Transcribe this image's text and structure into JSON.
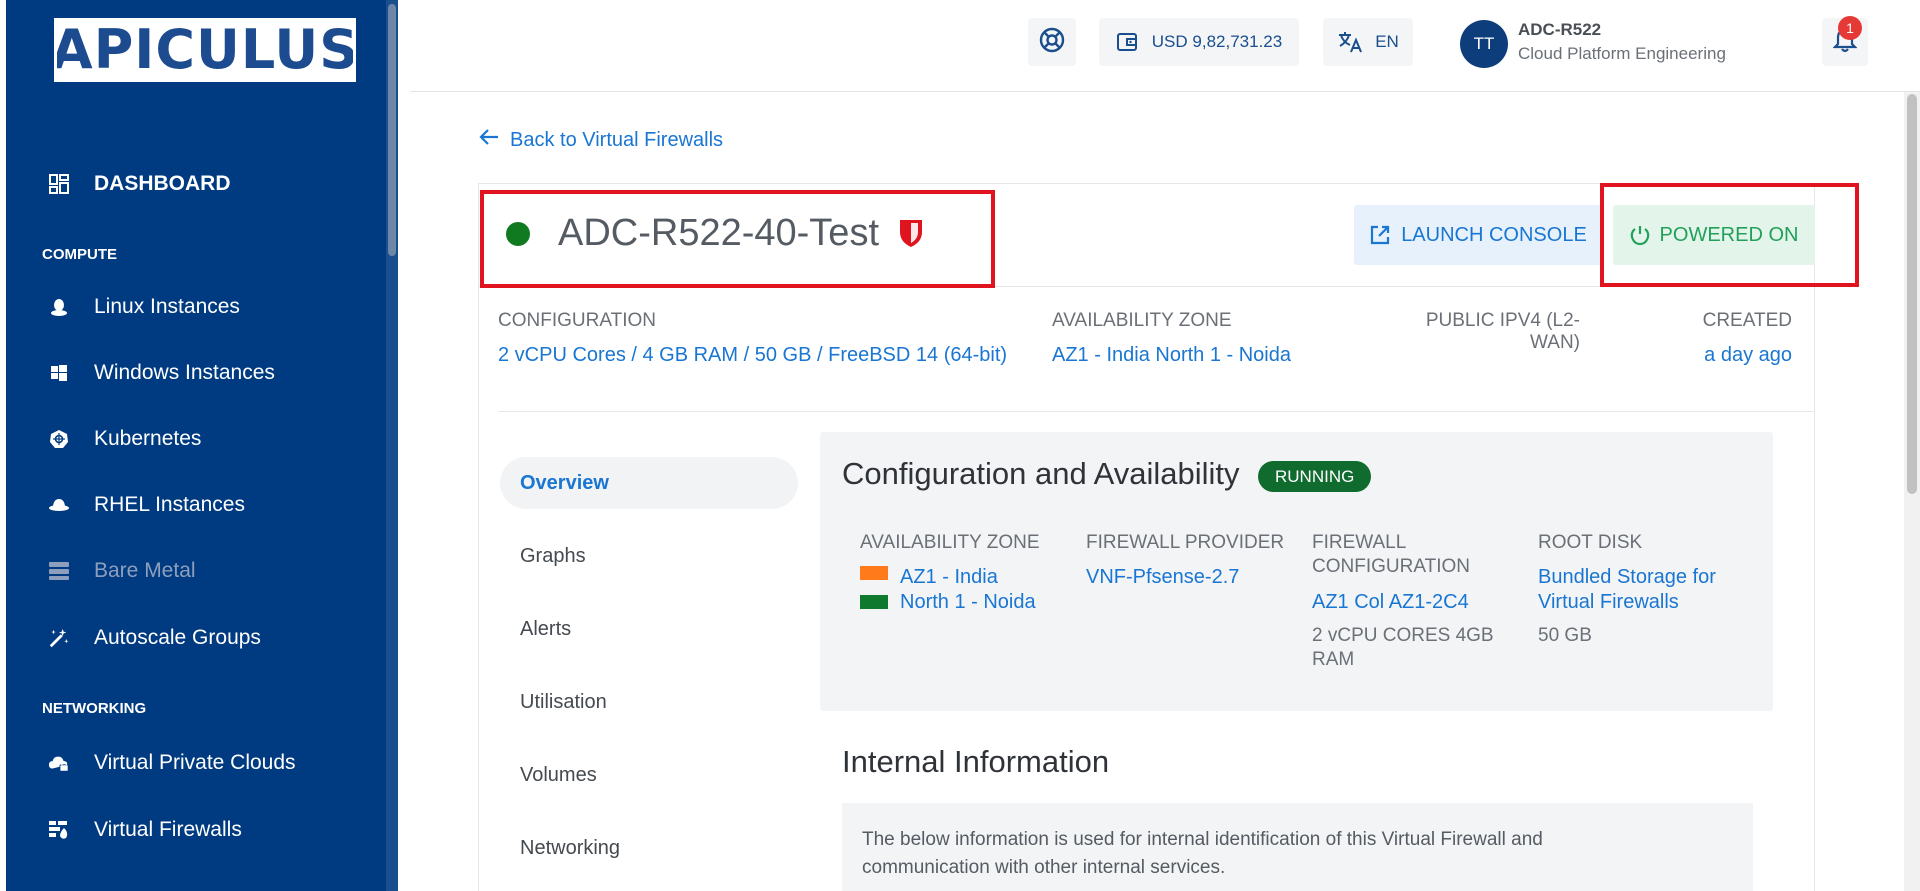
{
  "brand": {
    "logo_text": "APICULUS"
  },
  "sidebar": {
    "items": [
      {
        "label": "DASHBOARD",
        "icon": "dashboard-icon"
      },
      {
        "label": "Linux Instances",
        "icon": "linux-icon"
      },
      {
        "label": "Windows Instances",
        "icon": "windows-icon"
      },
      {
        "label": "Kubernetes",
        "icon": "kubernetes-icon"
      },
      {
        "label": "RHEL Instances",
        "icon": "redhat-icon"
      },
      {
        "label": "Bare Metal",
        "icon": "server-icon"
      },
      {
        "label": "Autoscale Groups",
        "icon": "magic-wand-icon"
      },
      {
        "label": "Virtual Private Clouds",
        "icon": "cloud-lock-icon"
      },
      {
        "label": "Virtual Firewalls",
        "icon": "firewall-icon"
      }
    ],
    "sections": {
      "compute": "COMPUTE",
      "networking": "NETWORKING"
    }
  },
  "topbar": {
    "balance": "USD 9,82,731.23",
    "language": "EN",
    "user_initials": "TT",
    "user_name": "ADC-R522",
    "user_org": "Cloud Platform Engineering",
    "notification_count": "1"
  },
  "page": {
    "back_link": "Back to Virtual Firewalls",
    "title": "ADC-R522-40-Test",
    "launch_console": "LAUNCH CONSOLE",
    "power_status": "POWERED ON",
    "meta": {
      "configuration_label": "CONFIGURATION",
      "configuration_value": "2 vCPU Cores / 4 GB RAM / 50 GB / FreeBSD 14 (64-bit)",
      "az_label": "AVAILABILITY ZONE",
      "az_value": "AZ1 - India North 1 - Noida",
      "ipv4_label_line1": "PUBLIC IPV4 (L2-",
      "ipv4_label_line2": "WAN)",
      "created_label": "CREATED",
      "created_value": "a day ago"
    },
    "tabs": [
      "Overview",
      "Graphs",
      "Alerts",
      "Utilisation",
      "Volumes",
      "Networking"
    ],
    "config_panel": {
      "title": "Configuration and Availability",
      "status": "RUNNING",
      "az_label": "AVAILABILITY ZONE",
      "az_line1": "AZ1 - India",
      "az_line2": "North 1 - Noida",
      "provider_label": "FIREWALL PROVIDER",
      "provider_value": "VNF-Pfsense-2.7",
      "fwconfig_label_line1": "FIREWALL",
      "fwconfig_label_line2": "CONFIGURATION",
      "fwconfig_value": "AZ1 Col AZ1-2C4",
      "fwconfig_sub_line1": "2 vCPU CORES 4GB",
      "fwconfig_sub_line2": "RAM",
      "rootdisk_label": "ROOT DISK",
      "rootdisk_line1": "Bundled Storage for",
      "rootdisk_line2": "Virtual Firewalls",
      "rootdisk_size": "50 GB"
    },
    "internal": {
      "title": "Internal Information",
      "text_line1": "The below information is used for internal identification of this Virtual Firewall and",
      "text_line2": "communication with other internal services."
    }
  },
  "colors": {
    "sidebar_bg": "#003a80",
    "accent": "#1976d2",
    "running_green": "#0f6b2e",
    "highlight_red": "#e0141e"
  }
}
